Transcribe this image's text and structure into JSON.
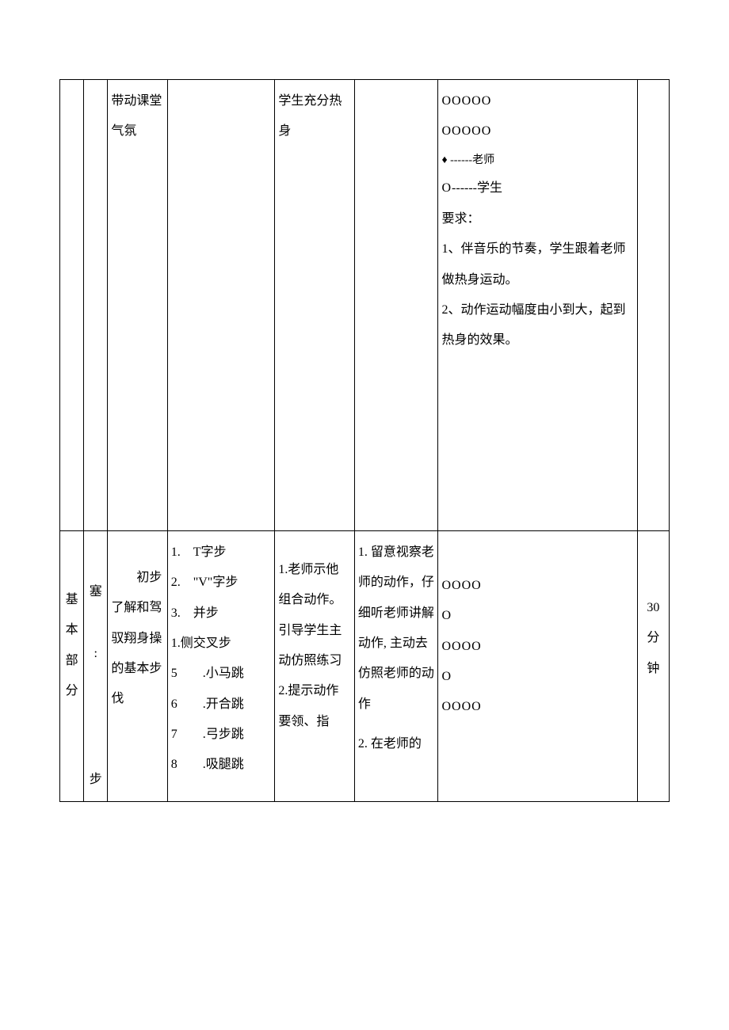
{
  "row1": {
    "col3": "带动课堂气氛",
    "col5": "学生充分热身",
    "col7_line1": "OOOOO",
    "col7_line2": "OOOOO",
    "col7_teacher": "♦ ------老师",
    "col7_student": "O------学生",
    "col7_req_label": "要求：",
    "col7_req1": "1、伴音乐的节奏，学生跟着老师做热身运动。",
    "col7_req2": "2、动作运动幅度由小到大，起到热身的效果。"
  },
  "row2": {
    "col1": "基本部分",
    "col2": "塞  :  步",
    "col3_indent": "　　初",
    "col3_rest": "步了解和驾驭翔身操的基本步伐",
    "col4_1": "1.　T字步",
    "col4_2": "2.　\"V\"字步",
    "col4_3": "3.　并步",
    "col4_4": "1.侧交叉步",
    "col4_5": "5　　.小马跳",
    "col4_6": "6　　.开合跳",
    "col4_7": "7　　.弓步跳",
    "col4_8": "8　　.吸腿跳",
    "col5_1": "1.老师示他组合动作。引导学生主动仿照练习",
    "col5_2": "2.提示动作要领、指",
    "col6_1": "1. 留意视察老师的动作，仔细听老师讲解动作, 主动去仿照老师的动作",
    "col6_2": "2. 在老师的",
    "col7_a": "OOOO",
    "col7_b": "O",
    "col7_c": "OOOO",
    "col7_d": "O",
    "col7_e": "OOOO",
    "col8": "30分钟"
  }
}
